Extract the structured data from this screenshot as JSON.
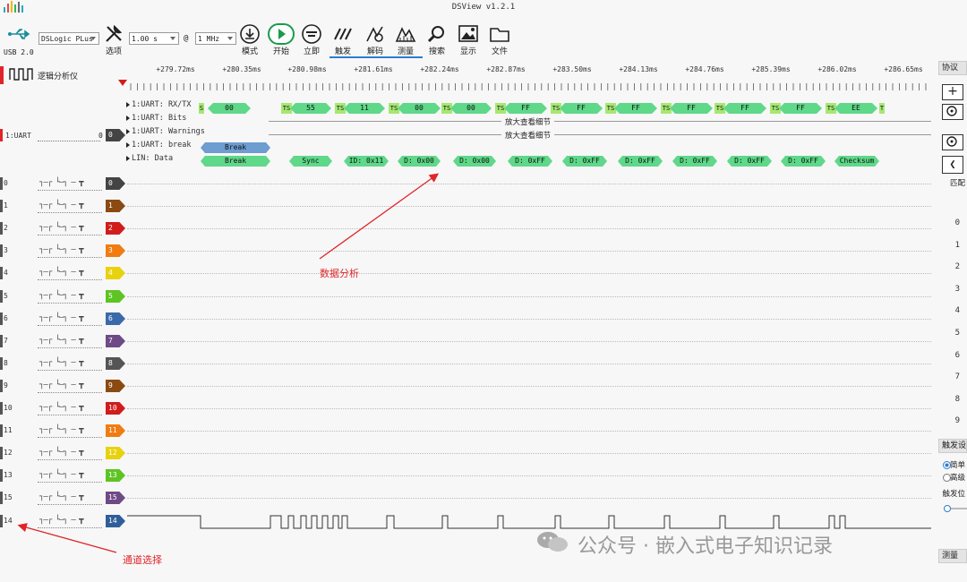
{
  "app": {
    "title": "DSView v1.2.1",
    "usb": "USB 2.0"
  },
  "toolbar": {
    "device": "DSLogic PLus",
    "options_label": "选项",
    "duration": "1.00 s",
    "at": "@",
    "samplerate": "1 MHz",
    "mode_label": "模式",
    "start_label": "开始",
    "instant_label": "立即",
    "trigger_label": "触发",
    "decode_label": "解码",
    "measure_label": "测量",
    "search_label": "搜索",
    "display_label": "显示",
    "file_label": "文件"
  },
  "ruler": {
    "ticks": [
      "+279.72ms",
      "+280.35ms",
      "+280.98ms",
      "+281.61ms",
      "+282.24ms",
      "+282.87ms",
      "+283.50ms",
      "+284.13ms",
      "+284.76ms",
      "+285.39ms",
      "+286.02ms",
      "+286.65ms"
    ]
  },
  "left": {
    "analyzer_label": "逻辑分析仪",
    "uart_label": "1:UART",
    "uart_num": "0"
  },
  "decoder": {
    "rows": [
      "1:UART: RX/TX",
      "1:UART: Bits",
      "1:UART: Warnings",
      "1:UART: break",
      "LIN: Data"
    ],
    "zoom_hint": "放大查看细节",
    "uart_bytes": [
      "00",
      "55",
      "11",
      "00",
      "00",
      "FF",
      "FF",
      "FF",
      "FF",
      "FF",
      "FF",
      "EE"
    ],
    "break_label": "Break",
    "lin_items": [
      "Sync",
      "ID: 0x11",
      "D: 0x00",
      "D: 0x00",
      "D: 0xFF",
      "D: 0xFF",
      "D: 0xFF",
      "D: 0xFF",
      "D: 0xFF",
      "D: 0xFF",
      "Checksum"
    ],
    "start_marker": "S",
    "stop_marker": "T",
    "stop_start_marker": "TS"
  },
  "channels": [
    {
      "num": "0",
      "tag": "0",
      "color": "#444444"
    },
    {
      "num": "1",
      "tag": "1",
      "color": "#8b4a12"
    },
    {
      "num": "2",
      "tag": "2",
      "color": "#d11c1c"
    },
    {
      "num": "3",
      "tag": "3",
      "color": "#f07c12"
    },
    {
      "num": "4",
      "tag": "4",
      "color": "#e8d20f"
    },
    {
      "num": "5",
      "tag": "5",
      "color": "#5ec423"
    },
    {
      "num": "6",
      "tag": "6",
      "color": "#3a6aa8"
    },
    {
      "num": "7",
      "tag": "7",
      "color": "#6e4a86"
    },
    {
      "num": "8",
      "tag": "8",
      "color": "#555555"
    },
    {
      "num": "9",
      "tag": "9",
      "color": "#8b4a12"
    },
    {
      "num": "10",
      "tag": "10",
      "color": "#d11c1c"
    },
    {
      "num": "11",
      "tag": "11",
      "color": "#f07c12"
    },
    {
      "num": "12",
      "tag": "12",
      "color": "#e8d20f"
    },
    {
      "num": "13",
      "tag": "13",
      "color": "#5ec423"
    },
    {
      "num": "15",
      "tag": "15",
      "color": "#6e4a86"
    },
    {
      "num": "14",
      "tag": "14",
      "color": "#2f5f9a"
    }
  ],
  "right_panel": {
    "protocol_tab": "协议",
    "match_label": "匹配",
    "numbers": [
      "0",
      "1",
      "2",
      "3",
      "4",
      "5",
      "6",
      "7",
      "8",
      "9"
    ],
    "trigger_settings": "触发设",
    "simple": "简单",
    "advanced": "高级",
    "trigger_pos": "触发位",
    "measure_tab": "测量"
  },
  "annotations": {
    "data_analysis": "数据分析",
    "channel_select": "通道选择"
  },
  "watermark": "公众号 · 嵌入式电子知识记录"
}
